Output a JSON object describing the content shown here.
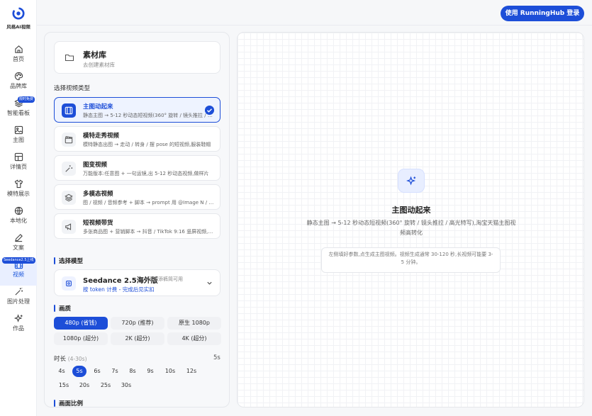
{
  "app": {
    "name": "风格AI视频",
    "login_button": "使用 RunningHub 登录"
  },
  "sidebar": {
    "items": [
      {
        "label": "首页",
        "icon": "home-icon"
      },
      {
        "label": "品牌库",
        "icon": "palette-icon"
      },
      {
        "label": "智能看板",
        "icon": "layers-icon",
        "badge": "限时免费"
      },
      {
        "label": "主图",
        "icon": "image-icon"
      },
      {
        "label": "详情页",
        "icon": "layout-icon"
      },
      {
        "label": "模特展示",
        "icon": "shirt-icon"
      },
      {
        "label": "本地化",
        "icon": "globe-icon"
      },
      {
        "label": "文案",
        "icon": "pen-icon"
      },
      {
        "label": "视频",
        "icon": "film-icon",
        "badge": "Seedance2.5上线",
        "active": true
      },
      {
        "label": "图片处理",
        "icon": "wand-icon"
      },
      {
        "label": "作品",
        "icon": "sparkle-icon"
      }
    ]
  },
  "library": {
    "title": "素材库",
    "subtitle": "去创建素材库"
  },
  "video_type_section": "选择视频类型",
  "video_types": [
    {
      "title": "主图动起来",
      "desc": "静态主图 → 5-12 秒动态短视频(360° 旋转 / 镜头推拉 / 高光特写)",
      "selected": true,
      "icon": "film-icon"
    },
    {
      "title": "模特走秀视频",
      "desc": "模特静态出图 → 走动 / 转身 / 摆 pose 的短视频,服装鞋帽",
      "icon": "clapperboard-icon"
    },
    {
      "title": "图变视频",
      "desc": "万能版本:任意图 + 一句运镜,出 5-12 秒动态视频,做样片",
      "icon": "magic-icon"
    },
    {
      "title": "多模态视频",
      "desc": "图 / 视频 / 音频参考 + 脚本 → prompt 用 @Image N / @Video N",
      "icon": "stack-icon"
    },
    {
      "title": "短视频带货",
      "desc": "多张商品图 + 营销脚本 → 抖音 / TikTok 9:16 竖屏视频,投流",
      "icon": "megaphone-icon"
    }
  ],
  "model_section": "选择模型",
  "model": {
    "name": "Seedance 2.5海外版",
    "subtitle": "添衣添裤简可用",
    "pricing": "按 token 计费 - 完成后见实扣"
  },
  "quality_section": "画质",
  "quality_options": [
    {
      "label": "480p (省钱)",
      "selected": true
    },
    {
      "label": "720p (推荐)"
    },
    {
      "label": "原生 1080p"
    },
    {
      "label": "1080p (超分)"
    },
    {
      "label": "2K (超分)"
    },
    {
      "label": "4K (超分)"
    }
  ],
  "duration": {
    "label": "时长",
    "range": "(4-30s)",
    "current": "5s",
    "options": [
      "4s",
      "5s",
      "6s",
      "7s",
      "8s",
      "9s",
      "10s",
      "12s",
      "15s",
      "20s",
      "25s",
      "30s"
    ],
    "selected": "5s"
  },
  "aspect_section": "画面比例",
  "preview": {
    "title": "主图动起来",
    "desc": "静态主图 → 5-12 秒动态短视频(360° 旋转 / 镜头推拉 / 高光特写),淘宝天猫主图视频高转化",
    "hint": "左侧填好参数,点生成主图视频。视频生成通常 30-120 秒,长视频可能要 3-5 分钟。"
  },
  "colors": {
    "accent": "#1d4ed8"
  }
}
